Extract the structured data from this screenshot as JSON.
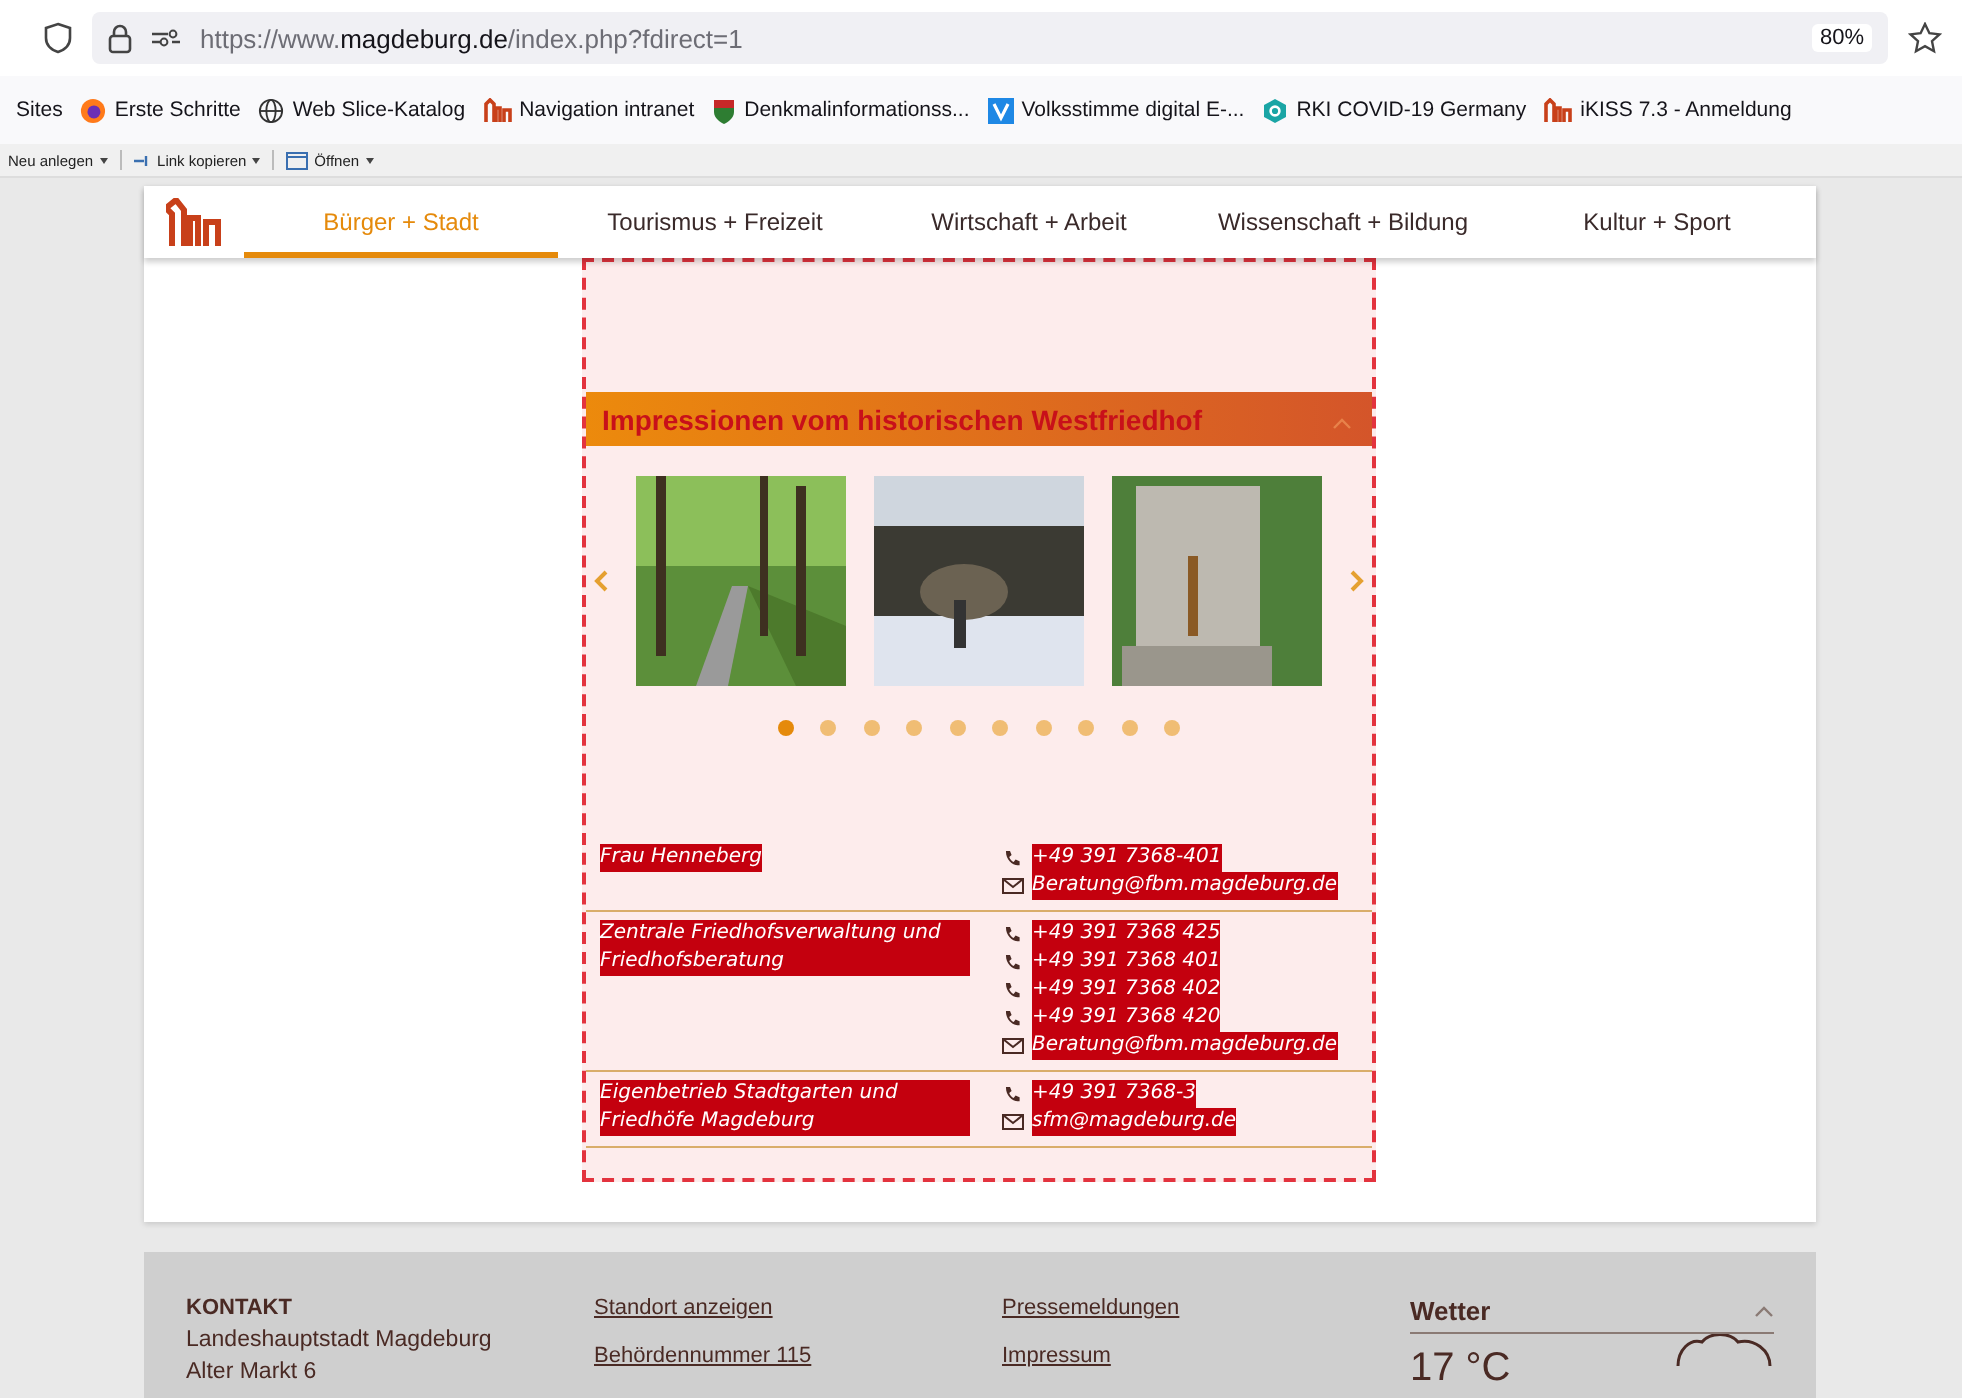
{
  "browser": {
    "url_host": "https://www.magdeburg.de",
    "url_path": "/index.php?fdirect=1",
    "zoom": "80%"
  },
  "bookmarks": [
    {
      "label": "Sites",
      "kind": "plain"
    },
    {
      "label": "Erste Schritte",
      "kind": "firefox"
    },
    {
      "label": "Web Slice-Katalog",
      "kind": "globe"
    },
    {
      "label": "Navigation intranet",
      "kind": "city"
    },
    {
      "label": "Denkmalinformationss...",
      "kind": "crest"
    },
    {
      "label": "Volksstimme digital E-...",
      "kind": "v"
    },
    {
      "label": "RKI COVID-19 Germany",
      "kind": "rki"
    },
    {
      "label": "iKISS 7.3 - Anmeldung",
      "kind": "city"
    }
  ],
  "toolbar": [
    {
      "label": "Neu anlegen",
      "kind": "plain"
    },
    {
      "label": "Link kopieren",
      "kind": "link"
    },
    {
      "label": "Öffnen",
      "kind": "window"
    }
  ],
  "nav": {
    "tabs": [
      {
        "label": "Bürger + Stadt",
        "selected": true
      },
      {
        "label": "Tourismus + Freizeit",
        "selected": false
      },
      {
        "label": "Wirtschaft + Arbeit",
        "selected": false
      },
      {
        "label": "Wissenschaft + Bildung",
        "selected": false
      },
      {
        "label": "Kultur + Sport",
        "selected": false
      }
    ]
  },
  "gallery": {
    "title": "Impressionen vom historischen Westfriedhof",
    "expanded": true,
    "photos": [
      {
        "kind": "avenue"
      },
      {
        "kind": "winter"
      },
      {
        "kind": "fountain"
      }
    ],
    "dots": [
      {
        "selected": true
      },
      {
        "selected": false
      },
      {
        "selected": false
      },
      {
        "selected": false
      },
      {
        "selected": false
      },
      {
        "selected": false
      },
      {
        "selected": false
      },
      {
        "selected": false
      },
      {
        "selected": false
      },
      {
        "selected": false
      }
    ]
  },
  "contacts": [
    {
      "name": "Frau Henneberg",
      "items": [
        {
          "kind": "phone",
          "text": "+49 391 7368-401"
        },
        {
          "kind": "email",
          "text": "Beratung@fbm.magdeburg.de"
        }
      ]
    },
    {
      "name": "Zentrale Friedhofsverwaltung und Friedhofsberatung",
      "items": [
        {
          "kind": "phone",
          "text": "+49 391 7368 425"
        },
        {
          "kind": "phone",
          "text": "+49 391 7368 401"
        },
        {
          "kind": "phone",
          "text": "+49 391 7368 402"
        },
        {
          "kind": "phone",
          "text": "+49 391 7368 420"
        },
        {
          "kind": "email",
          "text": "Beratung@fbm.magdeburg.de"
        }
      ]
    },
    {
      "name": "Eigenbetrieb Stadtgarten und Friedhöfe Magdeburg",
      "items": [
        {
          "kind": "phone",
          "text": "+49 391 7368-3"
        },
        {
          "kind": "email",
          "text": "sfm@magdeburg.de"
        }
      ]
    }
  ],
  "footer": {
    "kontakt": {
      "heading": "KONTAKT",
      "lines": [
        "Landeshauptstadt Magdeburg",
        "Alter Markt 6"
      ]
    },
    "links_1": [
      "Standort anzeigen",
      "Behördennummer 115"
    ],
    "links_2": [
      "Pressemeldungen",
      "Impressum"
    ],
    "weather": {
      "title": "Wetter",
      "expanded": true,
      "temperature": "17 °C"
    }
  }
}
